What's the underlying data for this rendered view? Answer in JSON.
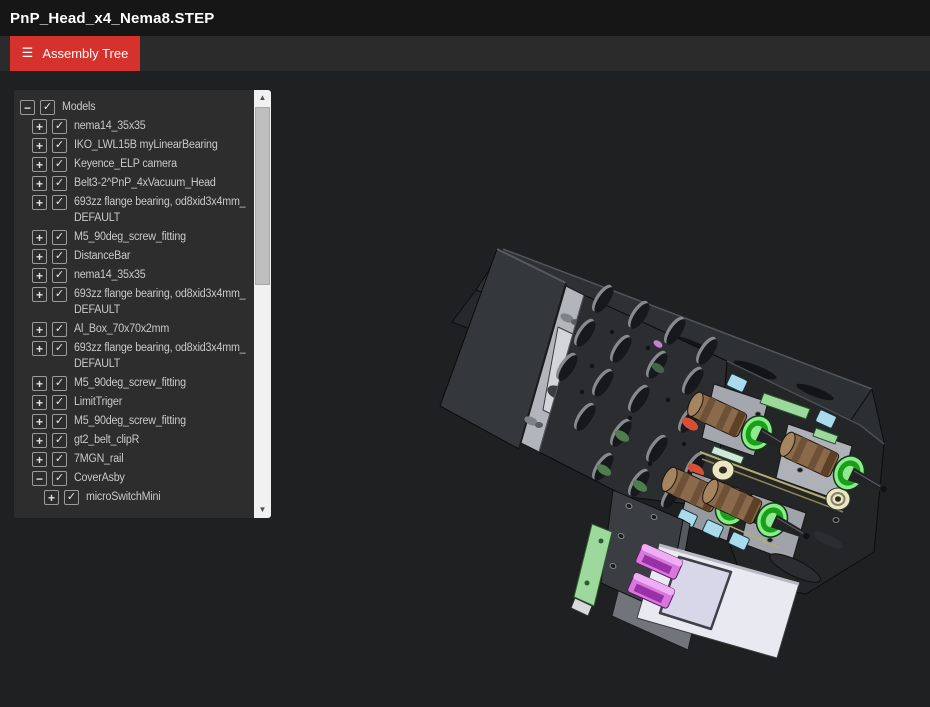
{
  "window": {
    "title": "PnP_Head_x4_Nema8.STEP"
  },
  "toolbar": {
    "assembly_tree": {
      "label": "Assembly Tree"
    }
  },
  "icons": {
    "menu": "☰",
    "collapse": "−",
    "expand": "+",
    "checkmark": "✓",
    "scroll_up": "▲",
    "scroll_down": "▼"
  },
  "tree": {
    "items": [
      {
        "label": "Models",
        "level": 0,
        "expanded": true,
        "checked": true
      },
      {
        "label": "nema14_35x35",
        "level": 1,
        "expanded": false,
        "checked": true
      },
      {
        "label": "IKO_LWL15B myLinearBearing",
        "level": 1,
        "expanded": false,
        "checked": true
      },
      {
        "label": "Keyence_ELP camera",
        "level": 1,
        "expanded": false,
        "checked": true
      },
      {
        "label": "Belt3-2^PnP_4xVacuum_Head",
        "level": 1,
        "expanded": false,
        "checked": true
      },
      {
        "label": "693zz flange bearing, od8xid3x4mm_\nDEFAULT",
        "level": 1,
        "expanded": false,
        "checked": true
      },
      {
        "label": "M5_90deg_screw_fitting",
        "level": 1,
        "expanded": false,
        "checked": true
      },
      {
        "label": "DistanceBar",
        "level": 1,
        "expanded": false,
        "checked": true
      },
      {
        "label": "nema14_35x35",
        "level": 1,
        "expanded": false,
        "checked": true
      },
      {
        "label": "693zz flange bearing, od8xid3x4mm_\nDEFAULT",
        "level": 1,
        "expanded": false,
        "checked": true
      },
      {
        "label": "Al_Box_70x70x2mm",
        "level": 1,
        "expanded": false,
        "checked": true
      },
      {
        "label": "693zz flange bearing, od8xid3x4mm_\nDEFAULT",
        "level": 1,
        "expanded": false,
        "checked": true
      },
      {
        "label": "M5_90deg_screw_fitting",
        "level": 1,
        "expanded": false,
        "checked": true
      },
      {
        "label": "LimitTriger",
        "level": 1,
        "expanded": false,
        "checked": true
      },
      {
        "label": "M5_90deg_screw_fitting",
        "level": 1,
        "expanded": false,
        "checked": true
      },
      {
        "label": "gt2_belt_clipR",
        "level": 1,
        "expanded": false,
        "checked": true
      },
      {
        "label": "7MGN_rail",
        "level": 1,
        "expanded": false,
        "checked": true
      },
      {
        "label": "CoverAsby",
        "level": 1,
        "expanded": true,
        "checked": true
      },
      {
        "label": "microSwitchMini",
        "level": 2,
        "expanded": false,
        "checked": true
      }
    ]
  },
  "colors": {
    "header_bg": "#161616",
    "tabbar_bg": "#2b2b2b",
    "canvas_bg": "#1f2021",
    "accent_red": "#d5312d",
    "panel_bg": "#2d2d2d",
    "panel_text": "#c9c9c9",
    "control_border": "#9a9a9a",
    "scrollbar_track": "#f1f1f1",
    "scrollbar_thumb": "#bfbfbf",
    "plate_dark": "#2b2d30",
    "cover_gray": "#34373b",
    "metal_light": "#b2b5bb",
    "face_gray": "#a4a8ae",
    "roller_green": "#18a018",
    "roller_green_light": "#8fe98f",
    "motor_tan": "#8a6a4b",
    "bearing_cream": "#ebe7c3",
    "pad_blue": "#a9dbec",
    "pcb_green": "#9dd99d",
    "connector_pink": "#d977dd",
    "box_white": "#e9e9f1",
    "box_panel": "#d7d7e9"
  }
}
